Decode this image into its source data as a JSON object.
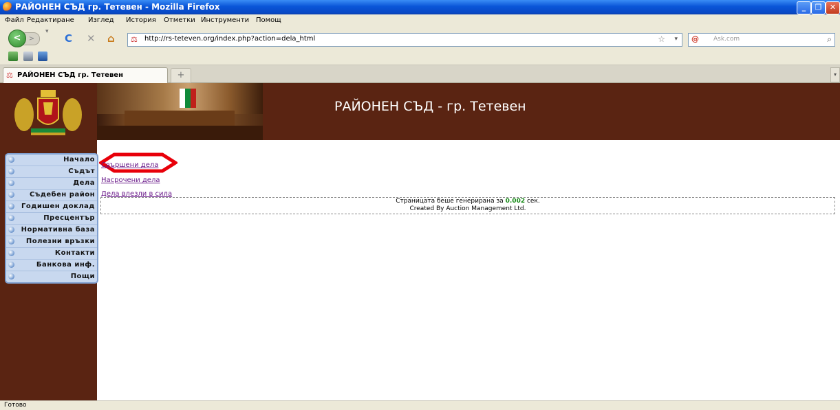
{
  "window": {
    "title": "РАЙОНЕН СЪД гр. Тетевен - Mozilla Firefox",
    "minimize": "_",
    "maximize": "❐",
    "close": "✕"
  },
  "menubar": {
    "items": [
      "Файл",
      "Редактиране",
      "Изглед",
      "История",
      "Отметки",
      "Инструменти",
      "Помощ"
    ]
  },
  "navbar": {
    "back": "<",
    "forward": ">",
    "reload": "C",
    "stop": "✕",
    "home": "⌂",
    "url": "http://rs-teteven.org/index.php?action=dela_html",
    "bookmark_star": "☆",
    "dropdown": "▾",
    "search_placeholder": "Ask.com",
    "search_engine": "@",
    "search_icon": "⌕"
  },
  "tabs": {
    "active_label": "РАЙОНЕН СЪД гр. Тетевен",
    "close": "✕",
    "new_tab": "+",
    "scroll": "▾"
  },
  "page": {
    "banner_title": "РАЙОНЕН СЪД - гр. Тетевен",
    "menu": [
      {
        "label": "Начало"
      },
      {
        "label": "Съдът"
      },
      {
        "label": "Дела"
      },
      {
        "label": "Съдебен район"
      },
      {
        "label": "Годишен доклад"
      },
      {
        "label": "Пресцентър"
      },
      {
        "label": "Нормативна база"
      },
      {
        "label": "Полезни връзки"
      },
      {
        "label": "Контакти"
      },
      {
        "label": "Банкова инф."
      },
      {
        "label": "Пощи"
      }
    ],
    "links": [
      "Свършени дела",
      "Насрочени дела",
      "Дела влезли в сила"
    ],
    "footer": {
      "generated_prefix": "Страницата беше генерирана за",
      "generated_time": "0.002",
      "generated_suffix": "сек.",
      "created_by": "Created By Auction Management Ltd."
    }
  },
  "status": {
    "text": "Готово"
  },
  "colors": {
    "brand_brown": "#5a2412",
    "menu_bg": "#c8d8ef",
    "highlight_red": "#e8000a",
    "link_visited": "#6a1a8a"
  }
}
